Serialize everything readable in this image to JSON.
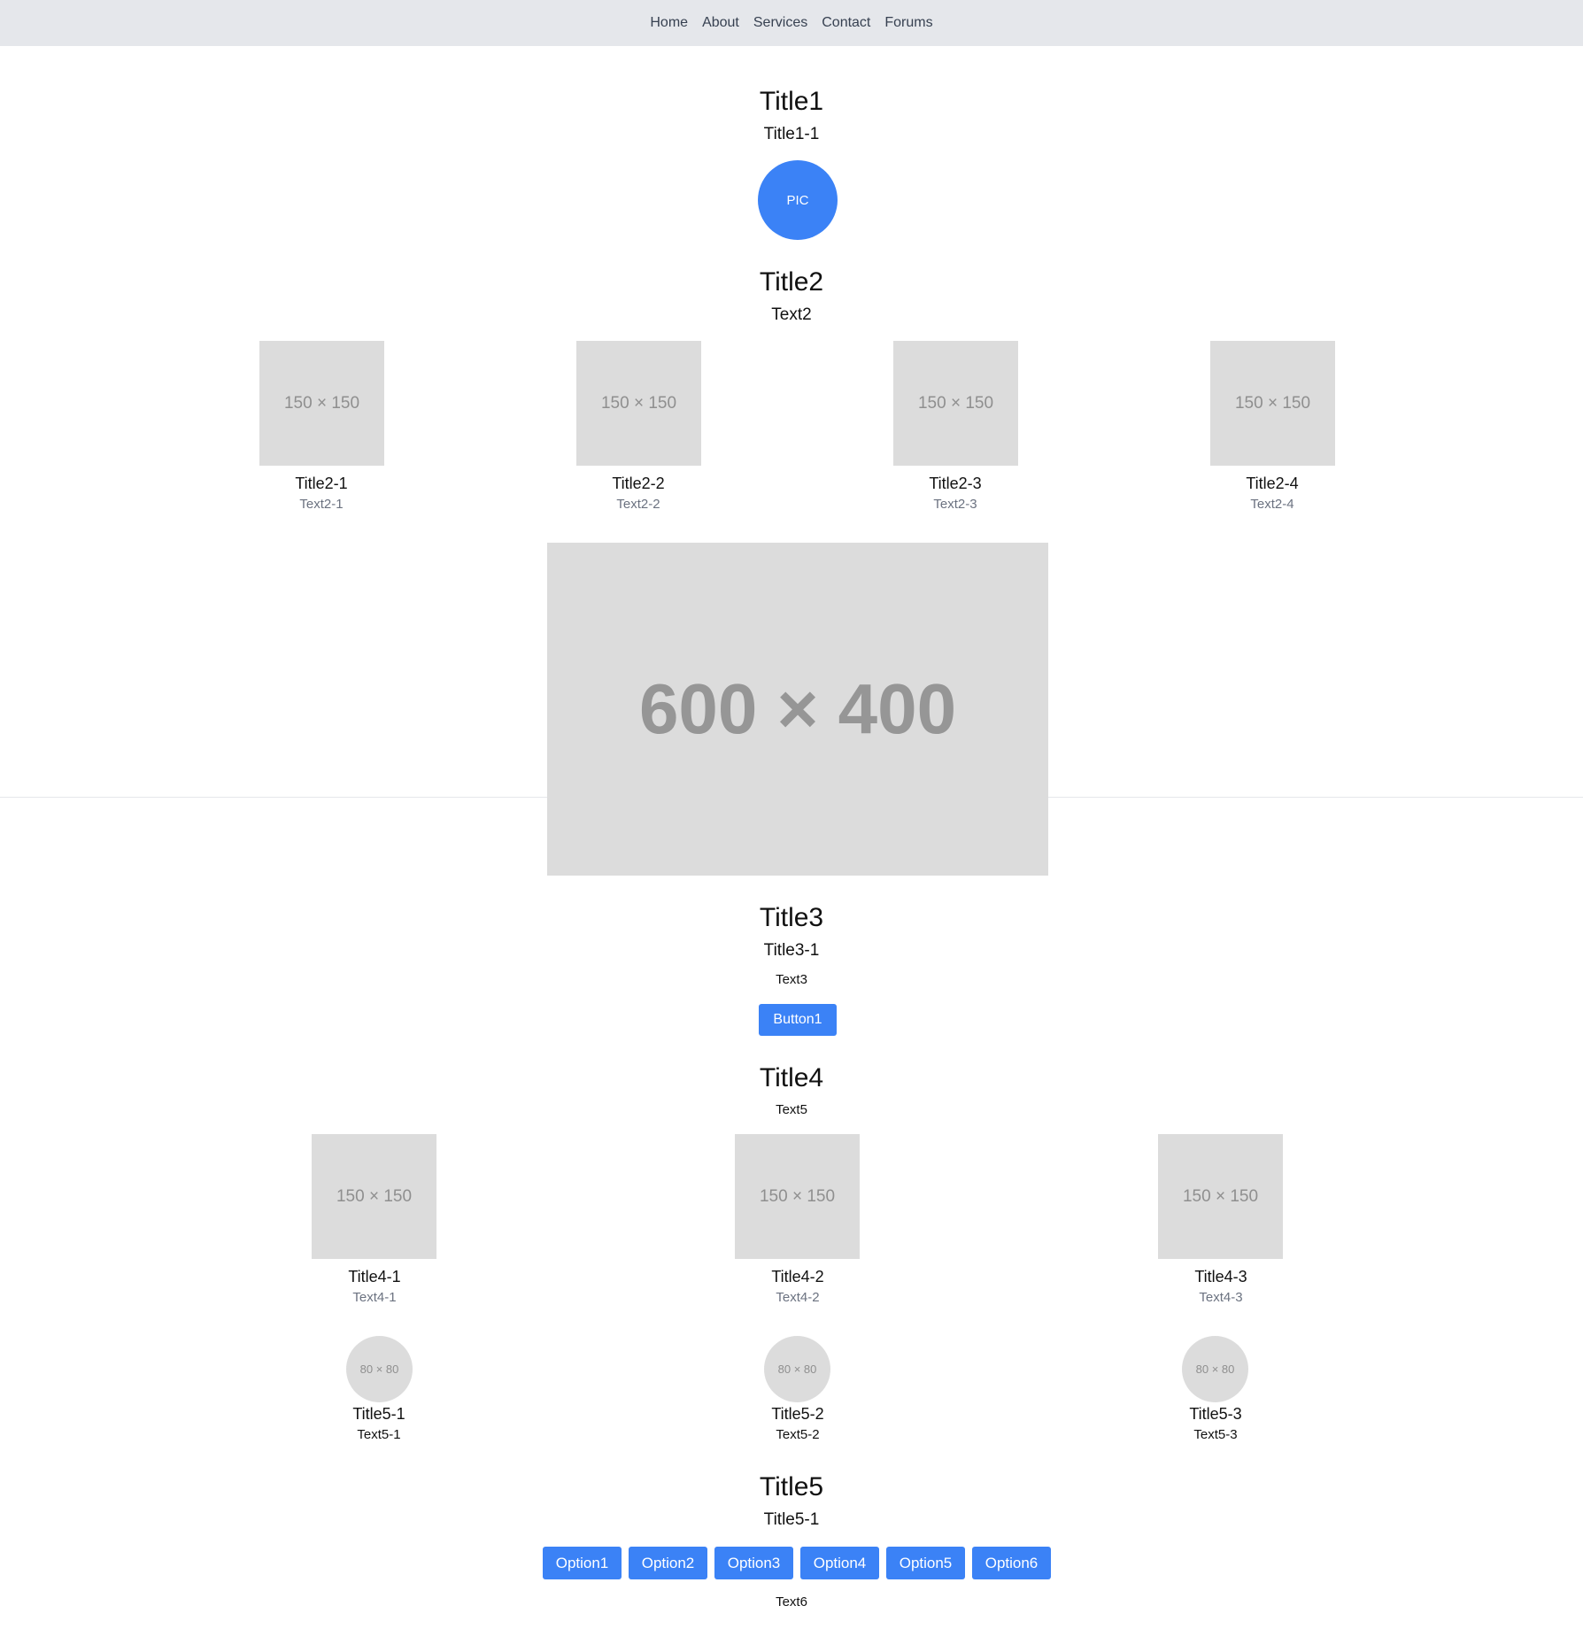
{
  "nav": {
    "items": [
      "Home",
      "About",
      "Services",
      "Contact",
      "Forums"
    ]
  },
  "hero": {
    "title": "Title1",
    "subtitle": "Title1-1",
    "pic_label": "PIC",
    "pic_color": "#3b82f6"
  },
  "section2": {
    "title": "Title2",
    "text": "Text2",
    "items": [
      {
        "image": "150 × 150",
        "title": "Title2-1",
        "text": "Text2-1"
      },
      {
        "image": "150 × 150",
        "title": "Title2-2",
        "text": "Text2-2"
      },
      {
        "image": "150 × 150",
        "title": "Title2-3",
        "text": "Text2-3"
      },
      {
        "image": "150 × 150",
        "title": "Title2-4",
        "text": "Text2-4"
      }
    ],
    "big_image": "600 × 400"
  },
  "section3": {
    "title": "Title3",
    "subtitle": "Title3-1",
    "text": "Text3",
    "button": "Button1",
    "button_color": "#3b82f6"
  },
  "section4": {
    "title": "Title4",
    "text": "Text5",
    "items": [
      {
        "image": "150 × 150",
        "title": "Title4-1",
        "text": "Text4-1"
      },
      {
        "image": "150 × 150",
        "title": "Title4-2",
        "text": "Text4-2"
      },
      {
        "image": "150 × 150",
        "title": "Title4-3",
        "text": "Text4-3"
      }
    ],
    "profiles": [
      {
        "image": "80 × 80",
        "title": "Title5-1",
        "text": "Text5-1"
      },
      {
        "image": "80 × 80",
        "title": "Title5-2",
        "text": "Text5-2"
      },
      {
        "image": "80 × 80",
        "title": "Title5-3",
        "text": "Text5-3"
      }
    ]
  },
  "section5": {
    "title": "Title5",
    "subtitle": "Title5-1",
    "options": [
      "Option1",
      "Option2",
      "Option3",
      "Option4",
      "Option5",
      "Option6"
    ],
    "text": "Text6"
  },
  "colors": {
    "nav_bg": "#e5e7eb",
    "placeholder_bg": "#dcdcdc",
    "accent": "#3b82f6"
  }
}
